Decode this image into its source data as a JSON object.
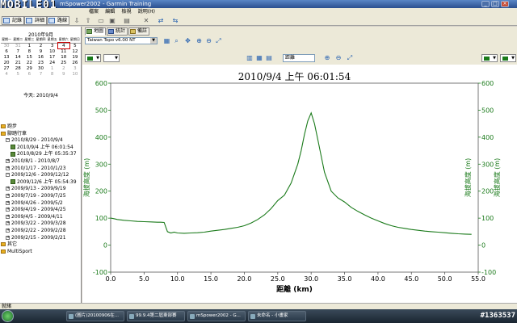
{
  "window": {
    "title": "mSpower2002 - Garmin Training",
    "logo": "MOBILE01"
  },
  "menubar": {
    "items": [
      "檔案",
      "編輯",
      "檢視",
      "說明(H)"
    ]
  },
  "toolbar": {
    "buttons": [
      {
        "label": "記錄"
      },
      {
        "label": "詳細"
      },
      {
        "label": "路線"
      }
    ]
  },
  "calendar": {
    "month_title": "2010年9月",
    "weekdays": [
      "星期一",
      "星期二",
      "星期三",
      "星期四",
      "星期五",
      "星期六",
      "星期日"
    ],
    "weeks": [
      [
        "30",
        "31",
        "1",
        "2",
        "3",
        "4",
        "5"
      ],
      [
        "6",
        "7",
        "8",
        "9",
        "10",
        "11",
        "12"
      ],
      [
        "13",
        "14",
        "15",
        "16",
        "17",
        "18",
        "19"
      ],
      [
        "20",
        "21",
        "22",
        "23",
        "24",
        "25",
        "26"
      ],
      [
        "27",
        "28",
        "29",
        "30",
        "1",
        "2",
        "3"
      ],
      [
        "4",
        "5",
        "6",
        "7",
        "8",
        "9",
        "10"
      ]
    ],
    "today_label": "今天: 2010/9/4"
  },
  "tree": [
    {
      "label": "跑步",
      "type": "folder",
      "indent": 0
    },
    {
      "label": "腳踏行車",
      "type": "folder",
      "indent": 0
    },
    {
      "label": "2010/8/29 - 2010/9/4",
      "type": "minus",
      "indent": 1
    },
    {
      "label": "2010/9/4 上午 06:01:54",
      "type": "run",
      "indent": 2
    },
    {
      "label": "2010/8/29 上午 05:35:37",
      "type": "run",
      "indent": 2
    },
    {
      "label": "2010/8/1 - 2010/8/7",
      "type": "plus",
      "indent": 1
    },
    {
      "label": "2010/1/17 - 2010/1/23",
      "type": "plus",
      "indent": 1
    },
    {
      "label": "2009/12/6 - 2009/12/12",
      "type": "minus",
      "indent": 1
    },
    {
      "label": "2009/12/6 上午 05:54:39",
      "type": "run",
      "indent": 2
    },
    {
      "label": "2009/9/13 - 2009/9/19",
      "type": "plus",
      "indent": 1
    },
    {
      "label": "2009/7/19 - 2009/7/25",
      "type": "plus",
      "indent": 1
    },
    {
      "label": "2009/4/26 - 2009/5/2",
      "type": "plus",
      "indent": 1
    },
    {
      "label": "2009/4/19 - 2009/4/25",
      "type": "plus",
      "indent": 1
    },
    {
      "label": "2009/4/5 - 2009/4/11",
      "type": "plus",
      "indent": 1
    },
    {
      "label": "2009/3/22 - 2009/3/28",
      "type": "plus",
      "indent": 1
    },
    {
      "label": "2009/2/22 - 2009/2/28",
      "type": "plus",
      "indent": 1
    },
    {
      "label": "2009/2/15 - 2009/2/21",
      "type": "plus",
      "indent": 1
    },
    {
      "label": "其它",
      "type": "folder",
      "indent": 0
    },
    {
      "label": "MultiSport",
      "type": "folder",
      "indent": 0
    }
  ],
  "tabs": [
    {
      "label": "地圖",
      "active": true
    },
    {
      "label": "統計",
      "active": false
    },
    {
      "label": "備註",
      "active": false
    }
  ],
  "map_select": {
    "value": "Taiwan Topo v6.00 NT"
  },
  "graph_select": {
    "value": "距離"
  },
  "colors": {
    "line": "#1a7a1a",
    "axis_text": "#1a7a1a"
  },
  "chart_data": {
    "type": "line",
    "title": "2010/9/4 上午 06:01:54",
    "xlabel": "距離 (km)",
    "ylabel_left": "海拔高度 (m)",
    "ylabel_right": "海拔高度 (m)",
    "xlim": [
      0,
      55
    ],
    "ylim": [
      -100,
      600
    ],
    "x_ticks": [
      "0.0",
      "5.0",
      "10.0",
      "15.0",
      "20.0",
      "25.0",
      "30.0",
      "35.0",
      "40.0",
      "45.0",
      "50.0",
      "55.0"
    ],
    "y_ticks": [
      "-100",
      "0",
      "100",
      "200",
      "300",
      "400",
      "500",
      "600"
    ],
    "grid": false,
    "series": [
      {
        "x": [
          0,
          0.5,
          1,
          2,
          3,
          4,
          5,
          6,
          7,
          7.5,
          8,
          8.5,
          9,
          9.5,
          10,
          11,
          12,
          13,
          14,
          15,
          16,
          17,
          18,
          19,
          20,
          21,
          22,
          23,
          24,
          25,
          26,
          27,
          28,
          28.5,
          29,
          29.5,
          30,
          30.5,
          31,
          31.5,
          32,
          33,
          34,
          35,
          36,
          37,
          38,
          39,
          40,
          41,
          42,
          43,
          44,
          45,
          46,
          47,
          48,
          49,
          50,
          51,
          52,
          53,
          54
        ],
        "y": [
          100,
          98,
          95,
          92,
          90,
          88,
          87,
          86,
          85,
          85,
          84,
          50,
          45,
          48,
          45,
          44,
          45,
          46,
          48,
          52,
          55,
          58,
          62,
          66,
          72,
          82,
          95,
          112,
          135,
          165,
          185,
          230,
          300,
          350,
          410,
          460,
          490,
          450,
          390,
          330,
          270,
          200,
          175,
          160,
          140,
          125,
          112,
          100,
          90,
          80,
          72,
          66,
          62,
          58,
          55,
          52,
          50,
          48,
          46,
          44,
          42,
          41,
          40
        ]
      }
    ]
  },
  "statusbar": {
    "text": "就緒"
  },
  "taskbar": {
    "items": [
      {
        "label": "(圖片)20100906在..."
      },
      {
        "label": "99.9.4第二屆東部賽"
      },
      {
        "label": "mSpower2002 - G..."
      },
      {
        "label": "未命名 - 小畫家"
      }
    ],
    "tray_text": "#1363537"
  }
}
